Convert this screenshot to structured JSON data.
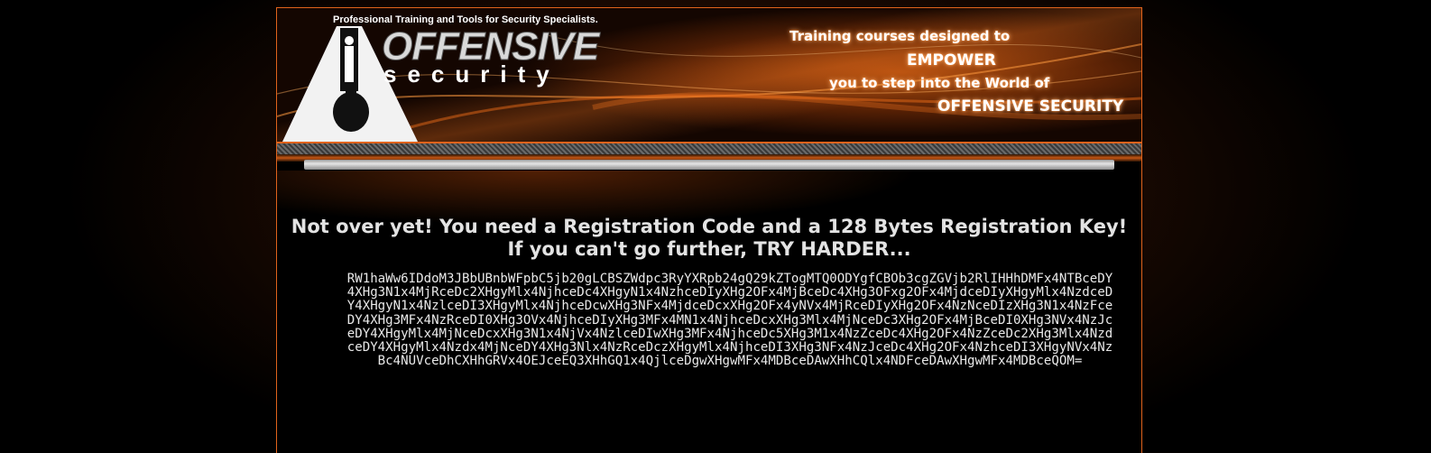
{
  "header": {
    "tagline": "Professional Training and Tools for Security Specialists.",
    "logo_word_1": "OFFENSIVE",
    "logo_word_2": "security",
    "promo": [
      "Training courses designed to",
      "EMPOWER",
      "you to step into the World of",
      "OFFENSIVE SECURITY"
    ],
    "colors": {
      "accent": "#e0631c",
      "background": "#000000"
    }
  },
  "main": {
    "headline_line_1": "Not over yet! You need a Registration Code and a 128 Bytes Registration Key!",
    "headline_line_2": "If you can't go further, TRY HARDER...",
    "encoded_text": "RW1haWw6IDdoM3JBbUBnbWFpbC5jb20gLCBSZWdpc3RyYXRpb24gQ29kZTogMTQ0ODYgfCBOb3cgZGVjb2RlIHHhDMFx4NTBceDY4XHg3N1x4MjRceDc2XHgyMlx4NjhceDc4XHgyN1x4NzhceDIyXHg2OFx4MjBceDc4XHg3OFxg2OFx4MjdceDIyXHgyMlx4NzdceDY4XHgyN1x4NzlceDI3XHgyMlx4NjhceDcwXHg3NFx4MjdceDcxXHg2OFx4yNVx4MjRceDIyXHg2OFx4NzNceDIzXHg3N1x4NzFceDY4XHg3MFx4NzRceDI0XHg3OVx4NjhceDIyXHg3MFx4MN1x4NjhceDcxXHg3Mlx4MjNceDc3XHg2OFx4MjBceDI0XHg3NVx4NzJceDY4XHgyMlx4MjNceDcxXHg3N1x4NjVx4NzlceDIwXHg3MFx4NjhceDc5XHg3M1x4NzZceDc4XHg2OFx4NzZceDc2XHg3Mlx4NzdceDY4XHgyMlx4Nzdx4MjNceDY4XHg3Nlx4NzRceDczXHgyMlx4NjhceDI3XHg3NFx4NzJceDc4XHg2OFx4NzhceDI3XHgyNVx4NzBc4NUVceDhCXHhGRVx4OEJceEQ3XHhGQ1x4QjlceDgwXHgwMFx4MDBceDAwXHhCQlx4NDFceDAwXHgwMFx4MDBceQOM="
  }
}
